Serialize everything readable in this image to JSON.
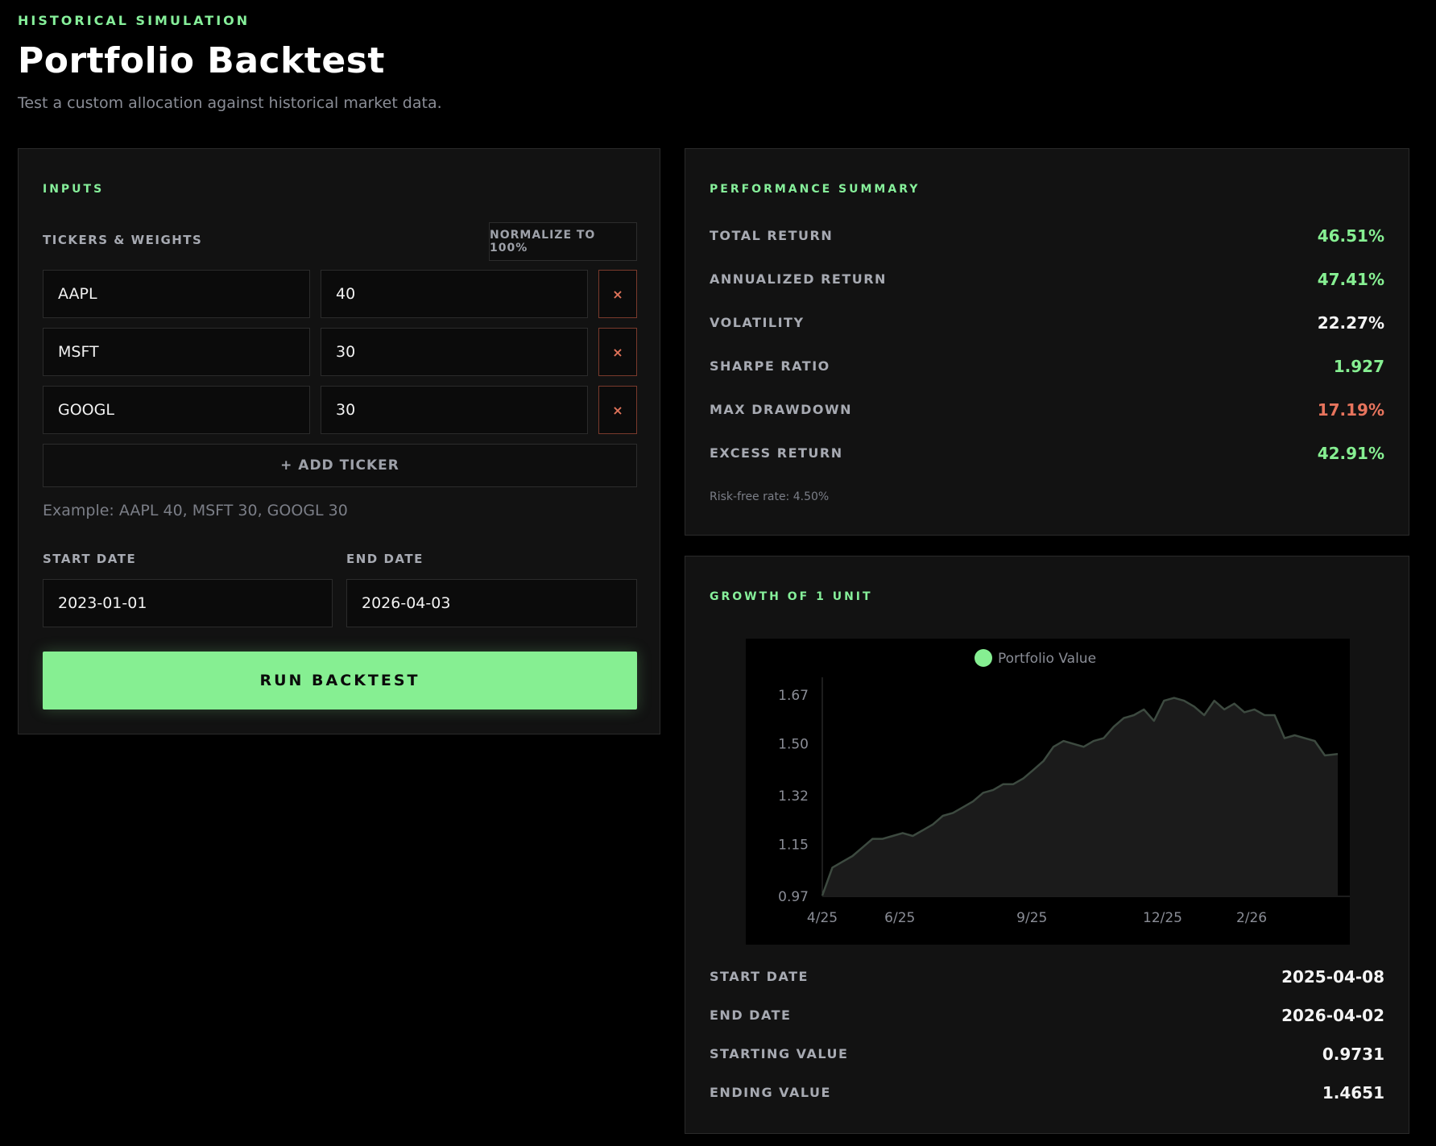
{
  "header": {
    "eyebrow": "HISTORICAL SIMULATION",
    "title": "Portfolio Backtest",
    "subtitle": "Test a custom allocation against historical market data."
  },
  "inputs": {
    "heading": "INPUTS",
    "tickers_label": "TICKERS & WEIGHTS",
    "normalize_label": "NORMALIZE TO 100%",
    "rows": [
      {
        "ticker": "AAPL",
        "weight": "40"
      },
      {
        "ticker": "MSFT",
        "weight": "30"
      },
      {
        "ticker": "GOOGL",
        "weight": "30"
      }
    ],
    "remove_glyph": "×",
    "add_label": "+ ADD TICKER",
    "example": "Example: AAPL 40, MSFT 30, GOOGL 30",
    "start_label": "START DATE",
    "start_value": "2023-01-01",
    "end_label": "END DATE",
    "end_value": "2026-04-03",
    "run_label": "RUN BACKTEST"
  },
  "summary": {
    "heading": "PERFORMANCE SUMMARY",
    "metrics": [
      {
        "label": "TOTAL RETURN",
        "value": "46.51%"
      },
      {
        "label": "ANNUALIZED RETURN",
        "value": "47.41%"
      },
      {
        "label": "VOLATILITY",
        "value": "22.27%"
      },
      {
        "label": "SHARPE RATIO",
        "value": "1.927"
      },
      {
        "label": "MAX DRAWDOWN",
        "value": "17.19%"
      },
      {
        "label": "EXCESS RETURN",
        "value": "42.91%"
      }
    ],
    "risk_free_note": "Risk-free rate: 4.50%"
  },
  "growth": {
    "heading": "GROWTH OF 1 UNIT",
    "stats": [
      {
        "label": "START DATE",
        "value": "2025-04-08"
      },
      {
        "label": "END DATE",
        "value": "2026-04-02"
      },
      {
        "label": "STARTING VALUE",
        "value": "0.9731"
      },
      {
        "label": "ENDING VALUE",
        "value": "1.4651"
      }
    ]
  },
  "colors": {
    "accent": "#86ef92",
    "negative": "#e7745d",
    "line": "#3d4a40"
  },
  "chart_data": {
    "type": "area",
    "title": "",
    "legend": [
      "Portfolio Value"
    ],
    "legend_position": "top-center",
    "xlabel": "",
    "ylabel": "",
    "x_ticks": [
      "4/25",
      "6/25",
      "9/25",
      "12/25",
      "2/26"
    ],
    "y_ticks": [
      "0.97",
      "1.15",
      "1.32",
      "1.50",
      "1.67"
    ],
    "ylim": [
      0.97,
      1.67
    ],
    "grid": false,
    "series": [
      {
        "name": "Portfolio Value",
        "x": [
          "2025-04-08",
          "2025-04-15",
          "2025-04-22",
          "2025-04-29",
          "2025-05-06",
          "2025-05-13",
          "2025-05-20",
          "2025-05-27",
          "2025-06-03",
          "2025-06-10",
          "2025-06-17",
          "2025-06-24",
          "2025-07-01",
          "2025-07-08",
          "2025-07-15",
          "2025-07-22",
          "2025-07-29",
          "2025-08-05",
          "2025-08-12",
          "2025-08-19",
          "2025-08-26",
          "2025-09-02",
          "2025-09-09",
          "2025-09-16",
          "2025-09-23",
          "2025-09-30",
          "2025-10-07",
          "2025-10-14",
          "2025-10-21",
          "2025-10-28",
          "2025-11-04",
          "2025-11-11",
          "2025-11-18",
          "2025-11-25",
          "2025-12-02",
          "2025-12-09",
          "2025-12-16",
          "2025-12-23",
          "2025-12-30",
          "2026-01-06",
          "2026-01-13",
          "2026-01-20",
          "2026-01-27",
          "2026-02-03",
          "2026-02-10",
          "2026-02-17",
          "2026-02-24",
          "2026-03-03",
          "2026-03-10",
          "2026-03-17",
          "2026-03-24",
          "2026-04-02"
        ],
        "values": [
          0.9731,
          1.07,
          1.09,
          1.11,
          1.14,
          1.17,
          1.17,
          1.18,
          1.19,
          1.18,
          1.2,
          1.22,
          1.25,
          1.26,
          1.28,
          1.3,
          1.33,
          1.34,
          1.36,
          1.36,
          1.38,
          1.41,
          1.44,
          1.49,
          1.51,
          1.5,
          1.49,
          1.51,
          1.52,
          1.56,
          1.59,
          1.6,
          1.62,
          1.58,
          1.65,
          1.66,
          1.65,
          1.63,
          1.6,
          1.65,
          1.62,
          1.64,
          1.61,
          1.62,
          1.6,
          1.6,
          1.52,
          1.53,
          1.52,
          1.51,
          1.46,
          1.4651
        ]
      }
    ]
  }
}
